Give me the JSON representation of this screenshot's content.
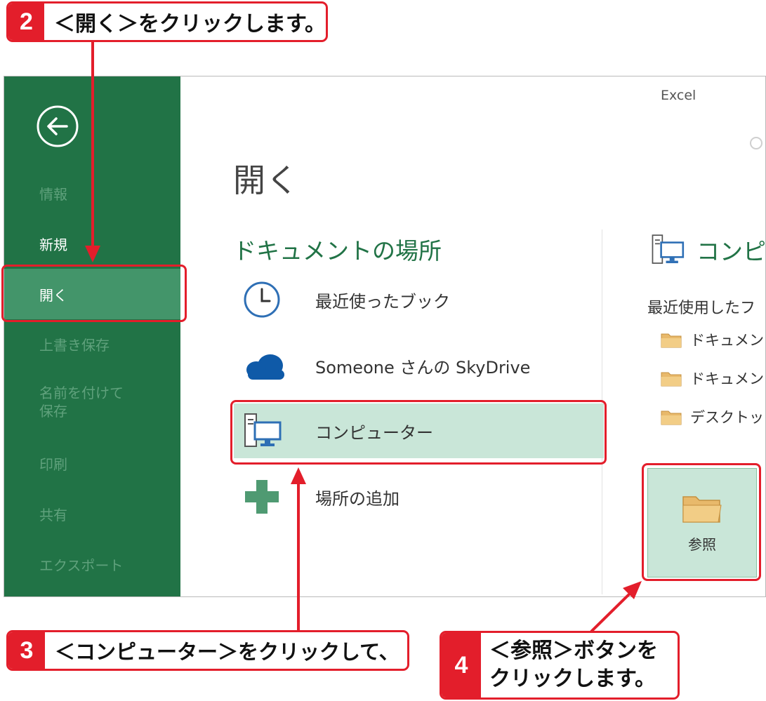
{
  "app_name": "Excel",
  "sidebar": {
    "items": [
      {
        "label": "情報",
        "state": "disabled"
      },
      {
        "label": "新規",
        "state": "normal"
      },
      {
        "label": "開く",
        "state": "selected"
      },
      {
        "label": "上書き保存",
        "state": "disabled"
      },
      {
        "label": "名前を付けて\n保存",
        "state": "disabled"
      },
      {
        "label": "印刷",
        "state": "disabled"
      },
      {
        "label": "共有",
        "state": "disabled"
      },
      {
        "label": "エクスポート",
        "state": "disabled"
      }
    ]
  },
  "page_title": "開く",
  "places": {
    "section_title": "ドキュメントの場所",
    "items": [
      {
        "label": "最近使ったブック",
        "icon": "clock-icon"
      },
      {
        "label": "Someone さんの SkyDrive",
        "icon": "cloud-icon"
      },
      {
        "label": "コンピューター",
        "icon": "computer-icon"
      },
      {
        "label": "場所の追加",
        "icon": "plus-icon"
      }
    ]
  },
  "right_panel": {
    "title": "コンピ",
    "recent_label": "最近使用したフ",
    "folders": [
      "ドキュメン",
      "ドキュメン",
      "デスクトップ"
    ],
    "browse_label": "参照"
  },
  "callouts": {
    "step2": {
      "num": "2",
      "text": "＜開く＞をクリックします。"
    },
    "step3": {
      "num": "3",
      "text": "＜コンピューター＞をクリックして、"
    },
    "step4": {
      "num": "4",
      "line1": "＜参照＞ボタンを",
      "line2": "クリックします。"
    }
  },
  "colors": {
    "sidebar": "#217346",
    "sidebar_selected": "#43956a",
    "accent": "#e31e2b",
    "place_selected": "#c9e6d8"
  }
}
